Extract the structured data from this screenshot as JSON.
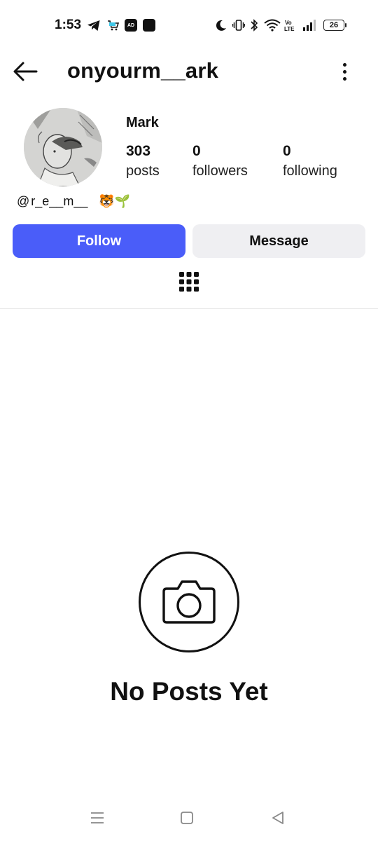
{
  "status_bar": {
    "time": "1:53",
    "battery": "26",
    "left_icons": [
      "telegram-icon",
      "shopping-app-icon",
      "ad-app-icon",
      "app-icon"
    ],
    "right_icons": [
      "moon-icon",
      "vibrate-icon",
      "bluetooth-icon",
      "wifi-icon",
      "volte-icon",
      "signal-icon",
      "battery-icon"
    ]
  },
  "header": {
    "username": "onyourm__ark"
  },
  "profile": {
    "display_name": "Mark",
    "stats": [
      {
        "value": "303",
        "label": "posts"
      },
      {
        "value": "0",
        "label": "followers"
      },
      {
        "value": "0",
        "label": "following"
      }
    ],
    "bio": {
      "threads_symbol": "@",
      "handle": "r_e__m__",
      "emojis": "🐯🌱"
    }
  },
  "actions": {
    "follow_label": "Follow",
    "message_label": "Message"
  },
  "empty_state": {
    "title": "No Posts Yet"
  },
  "colors": {
    "follow_button": "#4a5df9",
    "message_button": "#efeff2",
    "text": "#111111"
  }
}
